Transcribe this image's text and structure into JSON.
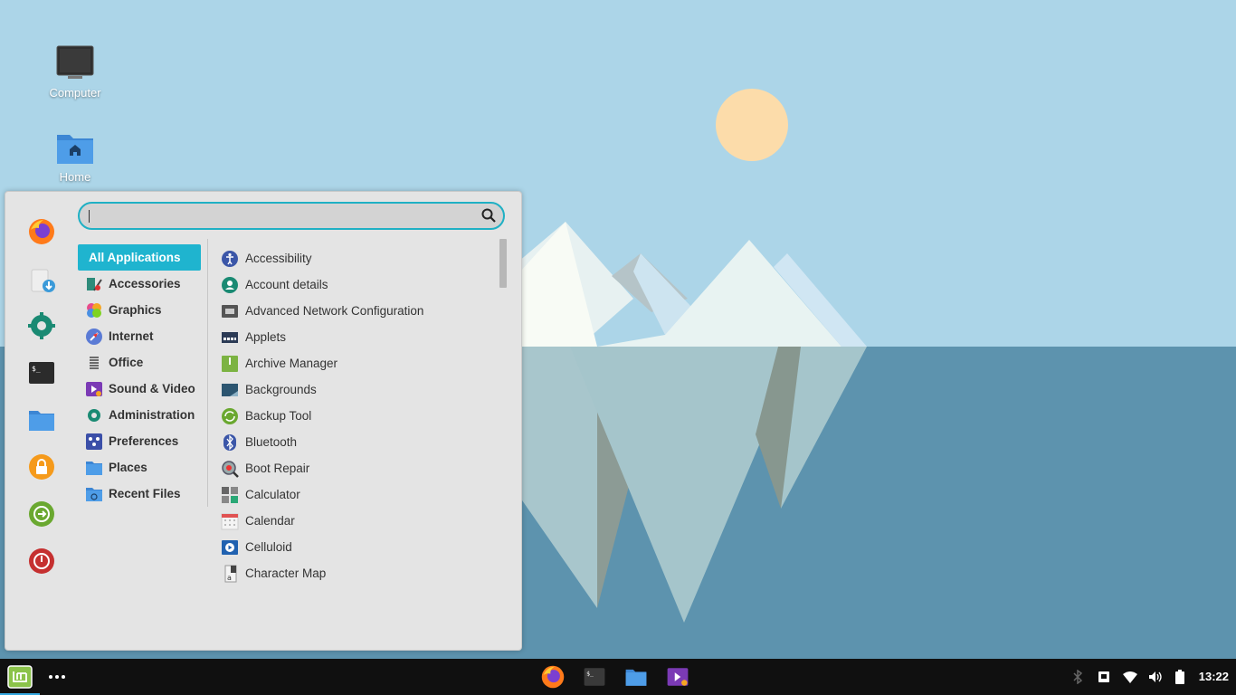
{
  "desktop": {
    "icons": [
      {
        "label": "Computer",
        "icon": "computer-icon"
      },
      {
        "label": "Home",
        "icon": "home-folder-icon"
      }
    ]
  },
  "menu": {
    "search": {
      "placeholder": "",
      "value": ""
    },
    "favorites": [
      "firefox-icon",
      "software-download-icon",
      "system-settings-icon",
      "terminal-icon",
      "files-icon",
      "lock-screen-icon",
      "logout-icon",
      "power-icon"
    ],
    "categories": [
      {
        "label": "All Applications",
        "active": true
      },
      {
        "label": "Accessories"
      },
      {
        "label": "Graphics"
      },
      {
        "label": "Internet"
      },
      {
        "label": "Office"
      },
      {
        "label": "Sound & Video"
      },
      {
        "label": "Administration"
      },
      {
        "label": "Preferences"
      },
      {
        "label": "Places"
      },
      {
        "label": "Recent Files"
      }
    ],
    "apps": [
      {
        "label": "Accessibility"
      },
      {
        "label": "Account details"
      },
      {
        "label": "Advanced Network Configuration"
      },
      {
        "label": "Applets"
      },
      {
        "label": "Archive Manager"
      },
      {
        "label": "Backgrounds"
      },
      {
        "label": "Backup Tool"
      },
      {
        "label": "Bluetooth"
      },
      {
        "label": "Boot Repair"
      },
      {
        "label": "Calculator"
      },
      {
        "label": "Calendar"
      },
      {
        "label": "Celluloid"
      },
      {
        "label": "Character Map"
      }
    ]
  },
  "taskbar": {
    "clock": "13:22",
    "launchers": [
      "firefox-icon",
      "terminal-icon",
      "files-icon",
      "media-icon"
    ],
    "tray": [
      "bluetooth-icon",
      "display-icon",
      "wifi-icon",
      "volume-icon",
      "battery-icon"
    ]
  },
  "colors": {
    "accent": "#1fb4cf",
    "sky": "#a9d3e6",
    "sea": "#5e94b0",
    "sun": "#fcdcaa",
    "panel": "#101010"
  }
}
